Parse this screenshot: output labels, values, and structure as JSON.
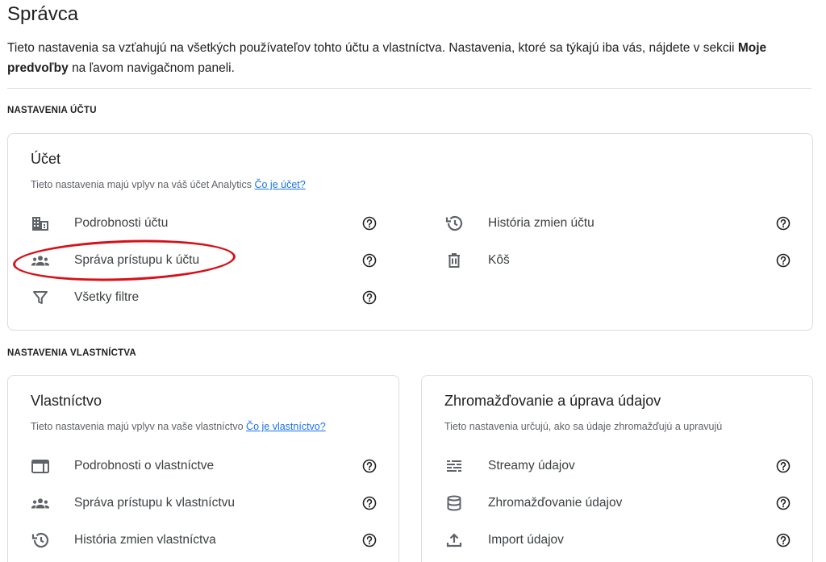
{
  "page": {
    "title": "Správca",
    "intro_text": "Tieto nastavenia sa vzťahujú na všetkých používateľov tohto účtu a vlastníctva. Nastavenia, ktoré sa týkajú iba vás, nájdete v sekcii",
    "intro_bold": "Moje predvoľby",
    "intro_tail": "na ľavom navigačnom paneli."
  },
  "account_section": {
    "heading": "NASTAVENIA ÚČTU",
    "card": {
      "title": "Účet",
      "desc": "Tieto nastavenia majú vplyv na váš účet Analytics",
      "link": "Čo je účet?",
      "items": [
        {
          "label": "Podrobnosti účtu",
          "icon": "building-icon"
        },
        {
          "label": "Správa prístupu k účtu",
          "icon": "people-icon"
        },
        {
          "label": "Všetky filtre",
          "icon": "filter-icon"
        },
        {
          "label": "História zmien účtu",
          "icon": "history-icon"
        },
        {
          "label": "Kôš",
          "icon": "trash-icon"
        }
      ]
    }
  },
  "property_section": {
    "heading": "NASTAVENIA VLASTNÍCTVA",
    "property_card": {
      "title": "Vlastníctvo",
      "desc": "Tieto nastavenia majú vplyv na vaše vlastníctvo",
      "link": "Čo je vlastníctvo?",
      "items": [
        {
          "label": "Podrobnosti o vlastníctve",
          "icon": "property-details-icon"
        },
        {
          "label": "Správa prístupu k vlastníctvu",
          "icon": "people-icon"
        },
        {
          "label": "História zmien vlastníctva",
          "icon": "history-icon"
        }
      ]
    },
    "data_card": {
      "title": "Zhromažďovanie a úprava údajov",
      "desc": "Tieto nastavenia určujú, ako sa údaje zhromažďujú a upravujú",
      "items": [
        {
          "label": "Streamy údajov",
          "icon": "streams-icon"
        },
        {
          "label": "Zhromažďovanie údajov",
          "icon": "database-icon"
        },
        {
          "label": "Import údajov",
          "icon": "upload-icon"
        }
      ]
    }
  },
  "colors": {
    "link": "#1a73e8",
    "highlight": "#d6111a",
    "icon": "#5f6368",
    "border": "#dadce0"
  }
}
